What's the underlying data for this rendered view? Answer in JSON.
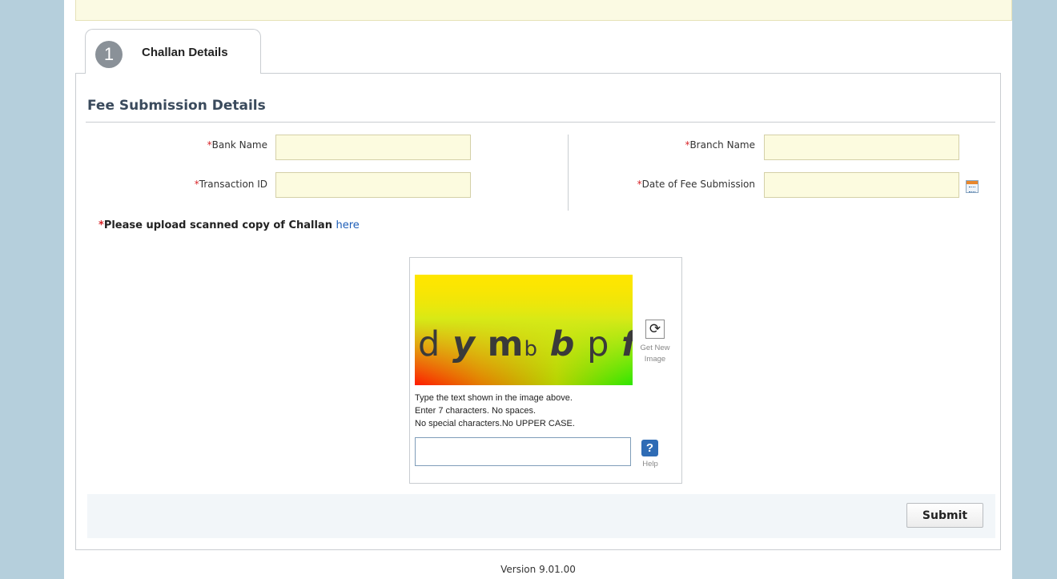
{
  "tab": {
    "number": "1",
    "label": "Challan Details"
  },
  "section": {
    "title": "Fee Submission Details"
  },
  "fields": {
    "bank_name": {
      "asterisk": "*",
      "label": "Bank Name",
      "value": ""
    },
    "branch_name": {
      "asterisk": "*",
      "label": "Branch Name",
      "value": ""
    },
    "transaction_id": {
      "asterisk": "*",
      "label": "Transaction ID",
      "value": ""
    },
    "date_of_fee_submission": {
      "asterisk": "*",
      "label": "Date of Fee Submission",
      "value": ""
    }
  },
  "upload": {
    "asterisk": "*",
    "text": "Please upload scanned copy of Challan ",
    "link": "here"
  },
  "captcha": {
    "chars": {
      "c1": "d",
      "c2": "y",
      "c3": "m",
      "c4": "b",
      "c5": "b",
      "c6": "p",
      "c7": "f"
    },
    "refresh_label": "Get New Image",
    "instructions": {
      "line1": "Type the text shown in the image above.",
      "line2": "Enter 7 characters. No spaces.",
      "line3": "No special characters.No UPPER CASE."
    },
    "help_icon": "?",
    "help_label": "Help",
    "input_value": ""
  },
  "actions": {
    "submit_label": "Submit"
  },
  "footer": {
    "version": "Version 9.01.00"
  },
  "icons": {
    "calendar": "calendar-icon",
    "refresh": "refresh-icon",
    "help": "help-icon"
  },
  "colors": {
    "background": "#b5cfdc",
    "required": "#d9262a",
    "link": "#1d5db7",
    "input_fill": "#fcfbdf",
    "help_blue": "#2f6cb5"
  }
}
